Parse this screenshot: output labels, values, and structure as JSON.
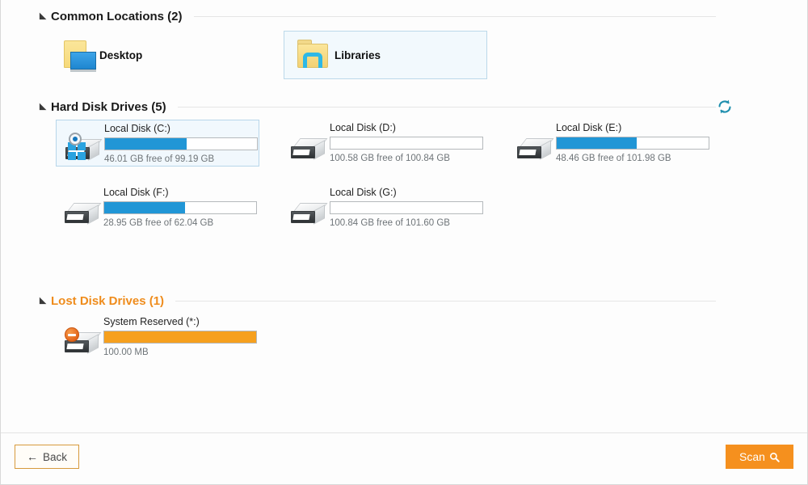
{
  "sections": {
    "common": {
      "title": "Common Locations (2)",
      "items": [
        {
          "label": "Desktop",
          "icon": "folder-desktop-icon",
          "selected": false
        },
        {
          "label": "Libraries",
          "icon": "folder-libraries-icon",
          "selected": true
        }
      ]
    },
    "hdd": {
      "title": "Hard Disk Drives (5)",
      "refresh_icon": "refresh-icon",
      "drives": [
        {
          "name": "Local Disk (C:)",
          "free": "46.01 GB free of 99.19 GB",
          "fill_pct": 53.6,
          "selected": true,
          "badge": "windows-logo-icon"
        },
        {
          "name": "Local Disk (D:)",
          "free": "100.58 GB free of 100.84 GB",
          "fill_pct": 0,
          "selected": false,
          "badge": ""
        },
        {
          "name": "Local Disk (E:)",
          "free": "48.46 GB free of 101.98 GB",
          "fill_pct": 52.5,
          "selected": false,
          "badge": ""
        },
        {
          "name": "Local Disk (F:)",
          "free": "28.95 GB free of 62.04 GB",
          "fill_pct": 53.3,
          "selected": false,
          "badge": ""
        },
        {
          "name": "Local Disk (G:)",
          "free": "100.84 GB free of 101.60 GB",
          "fill_pct": 0,
          "selected": false,
          "badge": ""
        }
      ]
    },
    "lost": {
      "title": "Lost Disk Drives (1)",
      "drives": [
        {
          "name": "System Reserved (*:)",
          "free": "100.00 MB",
          "fill_pct": 100,
          "selected": false,
          "badge": "no-entry-icon"
        }
      ]
    }
  },
  "footer": {
    "back_label": "Back",
    "back_icon": "arrow-left-icon",
    "scan_label": "Scan",
    "scan_icon": "magnifier-icon"
  },
  "colors": {
    "accent_orange": "#f5901e",
    "bar_blue": "#2196d6",
    "bar_orange": "#f6a01e",
    "lost_header": "#ef8c1c",
    "selected_bg": "#f1f8fd"
  }
}
